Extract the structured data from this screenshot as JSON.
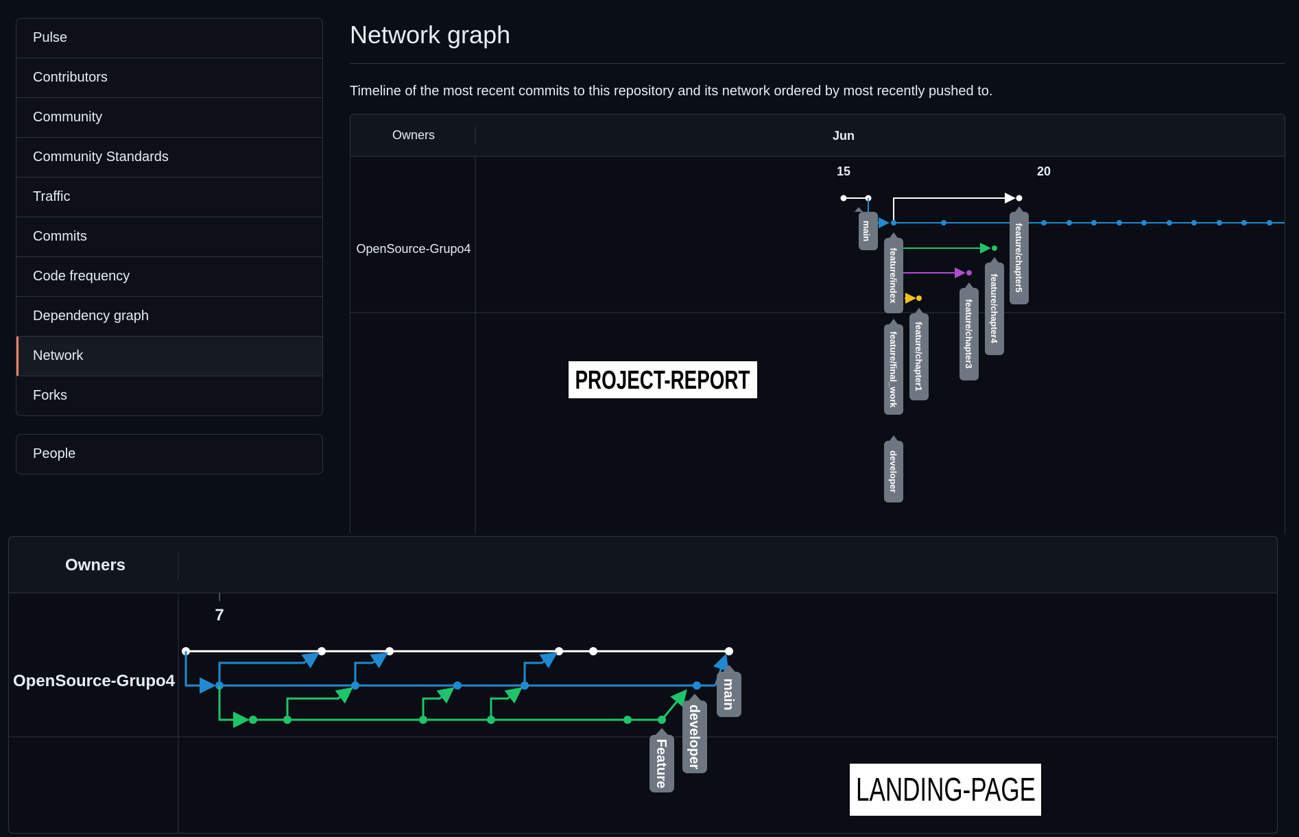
{
  "sidebar": {
    "items": [
      {
        "label": "Pulse"
      },
      {
        "label": "Contributors"
      },
      {
        "label": "Community"
      },
      {
        "label": "Community Standards"
      },
      {
        "label": "Traffic"
      },
      {
        "label": "Commits"
      },
      {
        "label": "Code frequency"
      },
      {
        "label": "Dependency graph"
      },
      {
        "label": "Network",
        "selected": true
      },
      {
        "label": "Forks"
      }
    ],
    "secondary": [
      {
        "label": "People"
      }
    ]
  },
  "header": {
    "title": "Network graph",
    "description": "Timeline of the most recent commits to this repository and its network ordered by most recently pushed to."
  },
  "graph_top": {
    "owners_label": "Owners",
    "month_label": "Jun",
    "day_labels": [
      "15",
      "20"
    ],
    "owner_name": "OpenSource-Grupo4",
    "overlay_label": "PROJECT-REPORT",
    "branches": [
      "main",
      "feature/index",
      "feature/final_work",
      "developer",
      "feature/chapter1",
      "feature/chapter3",
      "feature/chapter4",
      "feature/chapter5"
    ]
  },
  "graph_bottom": {
    "owners_label": "Owners",
    "day_label": "7",
    "owner_name": "OpenSource-Grupo4",
    "overlay_label": "LANDING-PAGE",
    "branches": [
      "main",
      "developer",
      "Feature"
    ]
  },
  "colors": {
    "background": "#0a0e15",
    "border": "#30363d",
    "selected_accent": "#f78166",
    "branch_main": "#ffffff",
    "branch_blue": "#1f8ad2",
    "branch_green": "#1ec46a",
    "branch_purple": "#b04bd2",
    "branch_yellow": "#f2c21b",
    "tag_bg": "#6e7681"
  }
}
